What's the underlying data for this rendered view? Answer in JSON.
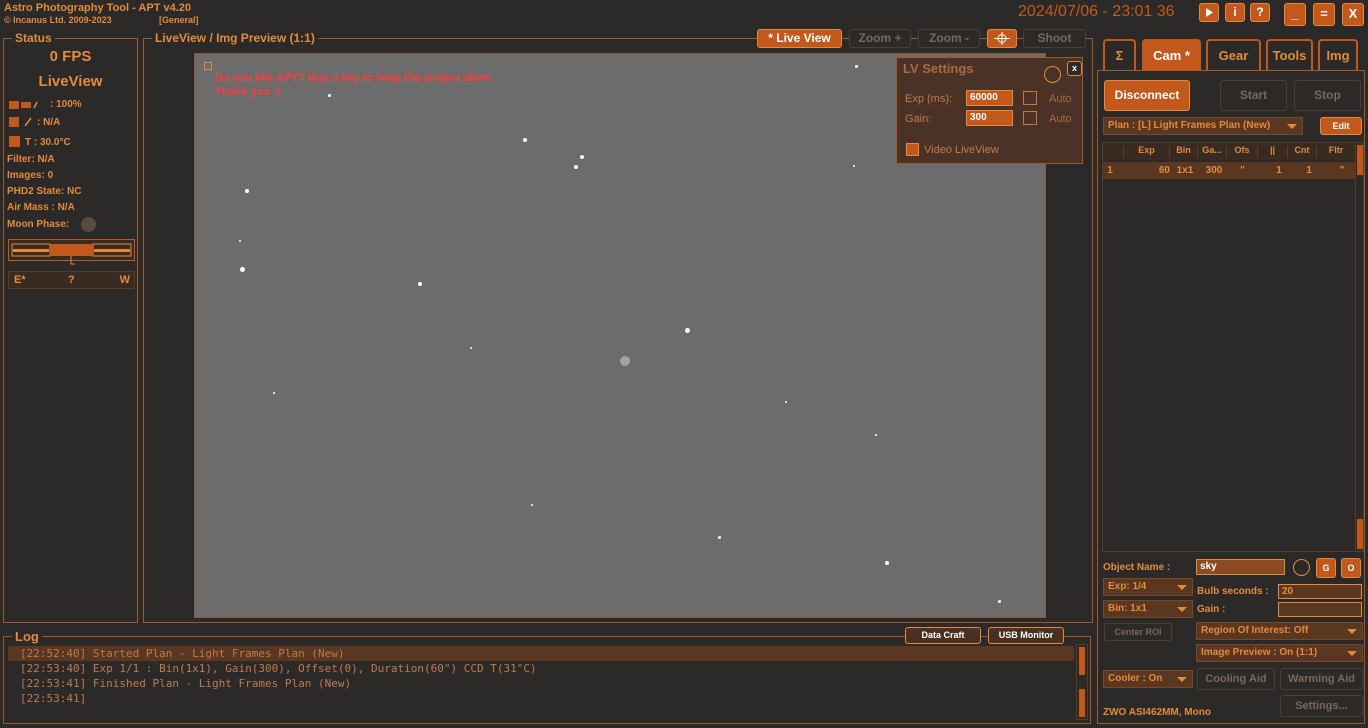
{
  "app": {
    "title": "Astro Photography Tool   -   APT v4.20",
    "copyright": "© Incanus Ltd. 2009-2023",
    "profile": "[General]",
    "datetime": "2024/07/06 - 23:01 36",
    "window_buttons": {
      "minimize": "_",
      "maximize": "=",
      "close": "X"
    },
    "top_icons": [
      "play-icon",
      "info-icon",
      "help-icon"
    ],
    "help_label": "?",
    "info_label": "i"
  },
  "status": {
    "title": "Status",
    "fps": "0 FPS",
    "mode": "LiveView",
    "battery": ": 100%",
    "power": ": N/A",
    "temp": "T : 30.0°C",
    "filter": "Filter: N/A",
    "images": "Images: 0",
    "phd2": "PHD2 State: NC",
    "airmass": "Air Mass : N/A",
    "moon": "Moon Phase:",
    "compass": {
      "east": "E*",
      "mid": "?",
      "west": "W"
    }
  },
  "preview": {
    "title": "LiveView / Img Preview (1:1)",
    "buttons": {
      "live_view": "* Live View",
      "zoom_in": "Zoom +",
      "zoom_out": "Zoom -",
      "shoot": "Shoot"
    },
    "message_line1": "Do you like APT? Buy a key to keep the project alive!",
    "message_line2": "Thank you :)"
  },
  "lv_settings": {
    "title": "LV Settings",
    "close": "x",
    "exp_label": "Exp (ms):",
    "exp_value": "60000",
    "gain_label": "Gain:",
    "gain_value": "300",
    "auto_label": "Auto",
    "video_label": "Video LiveView"
  },
  "tabs": [
    "Σ",
    "Cam *",
    "Gear",
    "Tools",
    "Img"
  ],
  "cam": {
    "disconnect": "Disconnect",
    "start": "Start",
    "stop": "Stop",
    "plan": "Plan : [L] Light Frames Plan (New)",
    "edit": "Edit",
    "columns": [
      "",
      "Exp",
      "Bin",
      "Ga...",
      "Ofs",
      "||",
      "Cnt",
      "Fltr"
    ],
    "rows": [
      [
        "1",
        "60",
        "1x1",
        "300",
        "\"",
        "1",
        "1",
        "\""
      ]
    ],
    "object_label": "Object Name :",
    "object_value": "sky",
    "exp_select": "Exp: 1/4",
    "bulb_label": "Bulb seconds :",
    "bulb_value": "20",
    "bin_select": "Bin: 1x1",
    "gain_label": "Gain :",
    "gain_value": "",
    "center_roi": "Center ROI",
    "roi": "Region Of Interest: Off",
    "image_preview": "Image Preview : On (1:1)",
    "cooler": "Cooler : On",
    "cooling_aid": "Cooling Aid",
    "warming_aid": "Warming Aid",
    "camera": "ZWO ASI462MM, Mono",
    "settings": "Settings...",
    "g_btn": "G",
    "o_btn": "O"
  },
  "log": {
    "title": "Log",
    "data_craft": "Data Craft",
    "usb_monitor": "USB Monitor",
    "lines": [
      "[22:52:40] Started Plan - Light Frames Plan (New)",
      "[22:53:40] Exp 1/1 : Bin(1x1), Gain(300), Offset(0), Duration(60\") CCD T(31°C)",
      "[22:53:41] Finished Plan - Light Frames Plan (New)",
      "[22:53:41]"
    ]
  },
  "colors": {
    "accent": "#c2581c",
    "text": "#e38a3c",
    "background": "#2c2a29",
    "message": "#ff3b3b"
  }
}
